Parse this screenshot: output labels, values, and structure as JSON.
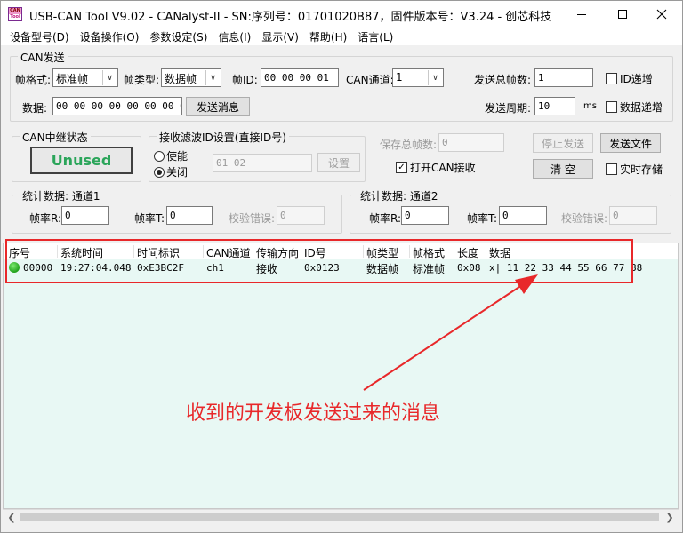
{
  "window": {
    "title": "USB-CAN Tool V9.02 - CANalyst-II - SN:序列号：01701020B87，固件版本号：V3.24 - 创芯科技",
    "icon_text_top": "CAN",
    "icon_text_bottom": "Tool"
  },
  "menu": [
    "设备型号(D)",
    "设备操作(O)",
    "参数设定(S)",
    "信息(I)",
    "显示(V)",
    "帮助(H)",
    "语言(L)"
  ],
  "can_send": {
    "group_title": "CAN发送",
    "frame_format_label": "帧格式:",
    "frame_format_value": "标准帧",
    "frame_type_label": "帧类型:",
    "frame_type_value": "数据帧",
    "frame_id_label": "帧ID:",
    "frame_id_value": "00 00 00 01",
    "channel_label": "CAN通道:",
    "channel_value": "1",
    "total_frames_label": "发送总帧数:",
    "total_frames_value": "1",
    "id_increment_label": "ID递增",
    "data_label": "数据:",
    "data_value": "00 00 00 00 00 00 00 00",
    "send_button": "发送消息",
    "period_label": "发送周期:",
    "period_value": "10",
    "period_unit": "ms",
    "data_increment_label": "数据递增"
  },
  "relay": {
    "group_title": "CAN中继状态",
    "status": "Unused"
  },
  "filter": {
    "group_title": "接收滤波ID设置(直接ID号)",
    "enable_label": "使能",
    "disable_label": "关闭",
    "id_value": "01 02",
    "set_button": "设置"
  },
  "right_panel": {
    "save_total_label": "保存总帧数:",
    "save_total_value": "0",
    "stop_send_button": "停止发送",
    "send_file_button": "发送文件",
    "open_can_receive_label": "打开CAN接收",
    "clear_button": "清 空",
    "realtime_save_label": "实时存储"
  },
  "stats1": {
    "group_title": "统计数据: 通道1",
    "rate_r_label": "帧率R:",
    "rate_r_value": "0",
    "rate_t_label": "帧率T:",
    "rate_t_value": "0",
    "check_err_label": "校验错误:",
    "check_err_value": "0"
  },
  "stats2": {
    "group_title": "统计数据: 通道2",
    "rate_r_label": "帧率R:",
    "rate_r_value": "0",
    "rate_t_label": "帧率T:",
    "rate_t_value": "0",
    "check_err_label": "校验错误:",
    "check_err_value": "0"
  },
  "table": {
    "headers": [
      "序号",
      "系统时间",
      "时间标识",
      "CAN通道",
      "传输方向",
      "ID号",
      "帧类型",
      "帧格式",
      "长度",
      "数据"
    ],
    "rows": [
      {
        "index": "00000",
        "sys_time": "19:27:04.048",
        "timestamp": "0xE3BC2F",
        "channel": "ch1",
        "direction": "接收",
        "id": "0x0123",
        "frame_type": "数据帧",
        "frame_format": "标准帧",
        "length": "0x08",
        "data": "x| 11 22 33 44 55 66 77 88"
      }
    ]
  },
  "annotation": {
    "text": "收到的开发板发送过来的消息",
    "color": "#e8282a"
  },
  "colors": {
    "table_bg": "#e8f8f4",
    "unused_text": "#2ba55a"
  }
}
